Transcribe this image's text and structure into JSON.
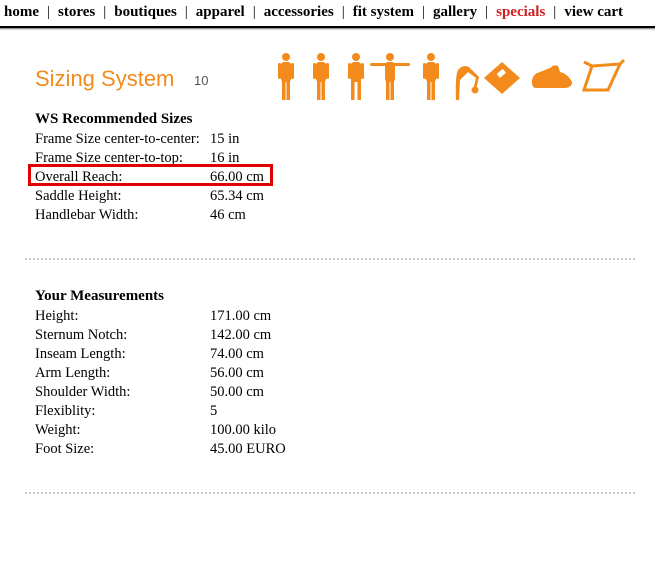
{
  "nav": {
    "items": [
      {
        "label": "home"
      },
      {
        "label": "stores"
      },
      {
        "label": "boutiques"
      },
      {
        "label": "apparel"
      },
      {
        "label": "accessories"
      },
      {
        "label": "fit system"
      },
      {
        "label": "gallery"
      },
      {
        "label": "specials",
        "highlight": true
      },
      {
        "label": "view cart"
      }
    ],
    "separator": "|"
  },
  "header": {
    "title": "Sizing System",
    "step": "10",
    "icons": [
      "standing-figure-icon",
      "standing-figure-icon",
      "standing-figure-icon",
      "arms-out-figure-icon",
      "standing-figure-icon",
      "bending-figure-icon",
      "scale-icon",
      "shoe-icon",
      "bike-frame-icon"
    ],
    "accent_color": "#f28a1c"
  },
  "recommended": {
    "title": "WS Recommended Sizes",
    "rows": [
      {
        "label": "Frame Size center-to-center:",
        "value": "15 in"
      },
      {
        "label": "Frame Size center-to-top:",
        "value": "16 in"
      },
      {
        "label": "Overall Reach:",
        "value": "66.00 cm"
      },
      {
        "label": "Saddle Height:",
        "value": "65.34 cm"
      },
      {
        "label": "Handlebar Width:",
        "value": "46 cm"
      }
    ]
  },
  "measurements": {
    "title": "Your Measurements",
    "rows": [
      {
        "label": "Height:",
        "value": "171.00 cm"
      },
      {
        "label": "Sternum Notch:",
        "value": "142.00 cm"
      },
      {
        "label": "Inseam Length:",
        "value": "74.00 cm"
      },
      {
        "label": "Arm Length:",
        "value": "56.00 cm"
      },
      {
        "label": "Shoulder Width:",
        "value": "50.00 cm"
      },
      {
        "label": "Flexiblity:",
        "value": "5"
      },
      {
        "label": "Weight:",
        "value": "100.00 kilo"
      },
      {
        "label": "Foot Size:",
        "value": "45.00 EURO"
      }
    ]
  },
  "highlight_color": "#e00000"
}
